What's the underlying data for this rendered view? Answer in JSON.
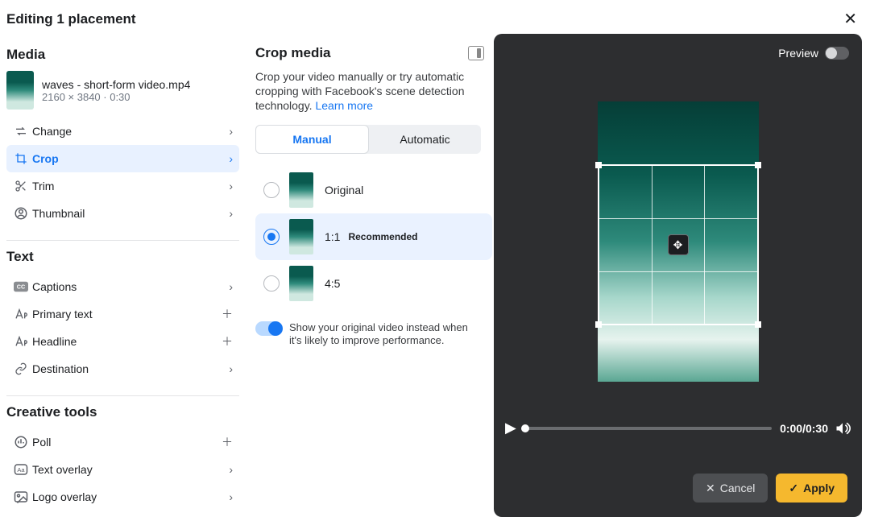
{
  "header": {
    "title": "Editing 1 placement"
  },
  "left": {
    "media_title": "Media",
    "file_name": "waves - short-form video.mp4",
    "file_meta": "2160 × 3840 · 0:30",
    "items": {
      "change": "Change",
      "crop": "Crop",
      "trim": "Trim",
      "thumbnail": "Thumbnail"
    },
    "text_title": "Text",
    "text_items": {
      "captions": "Captions",
      "primary": "Primary text",
      "headline": "Headline",
      "destination": "Destination"
    },
    "tools_title": "Creative tools",
    "tools_items": {
      "poll": "Poll",
      "text_overlay": "Text overlay",
      "logo_overlay": "Logo overlay"
    }
  },
  "mid": {
    "title": "Crop media",
    "desc": "Crop your video manually or try automatic cropping with Facebook's scene detection technology. ",
    "learn_more": "Learn more",
    "tab_manual": "Manual",
    "tab_auto": "Automatic",
    "ratio_original": "Original",
    "ratio_1_1": "1:1",
    "recommended": "Recommended",
    "ratio_4_5": "4:5",
    "show_original_text": "Show your original video instead when it's likely to improve performance."
  },
  "right": {
    "preview_label": "Preview",
    "time_text": "0:00/0:30",
    "cancel": "Cancel",
    "apply": "Apply"
  }
}
